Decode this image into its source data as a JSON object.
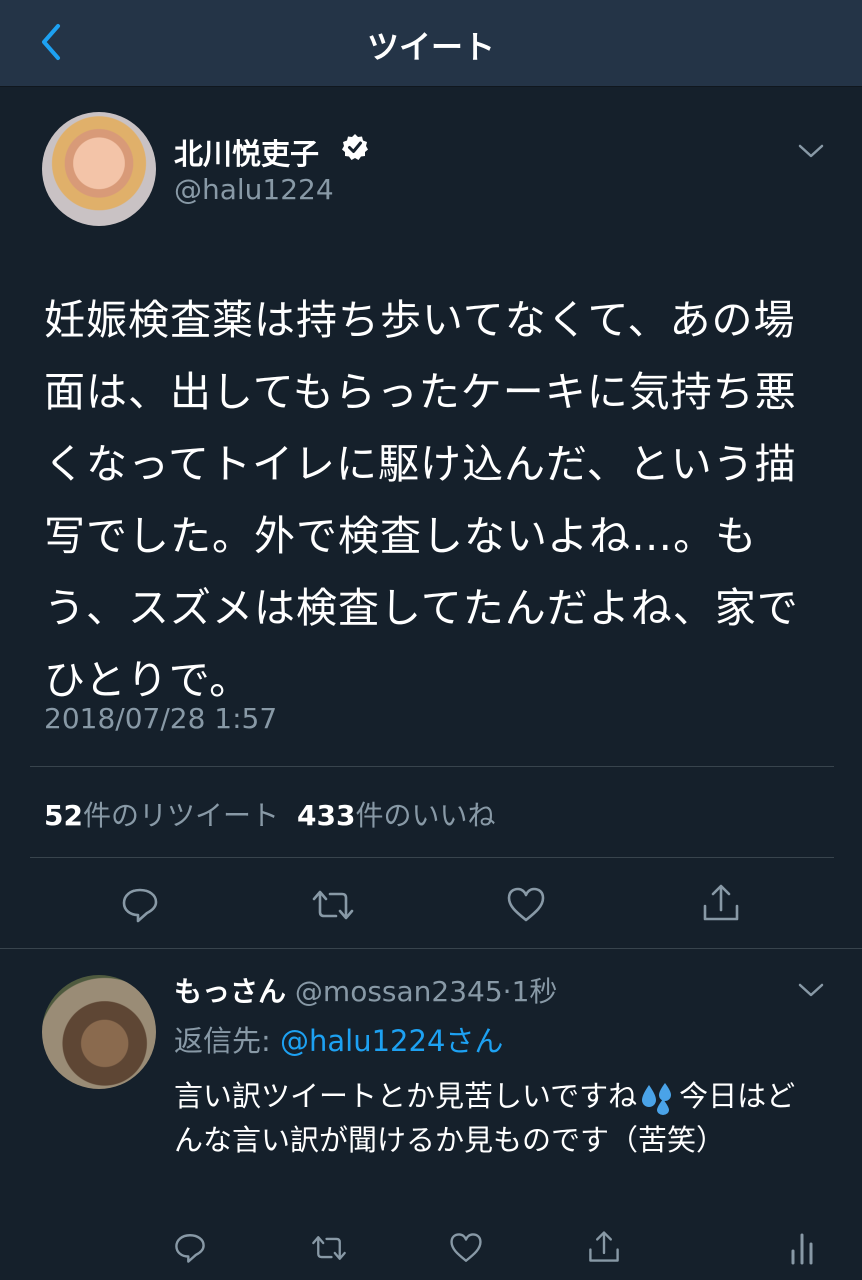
{
  "navbar": {
    "title": "ツイート",
    "back_icon": "chevron-left-icon",
    "accent": "#1da1f2"
  },
  "tweet": {
    "author_name": "北川悦吏子",
    "author_handle": "@halu1224",
    "verified": true,
    "text": "妊娠検査薬は持ち歩いてなくて、あの場面は、出してもらったケーキに気持ち悪くなってトイレに駆け込んだ、という描写でした。外で検査しないよね…。もう、スズメは検査してたんだよね、家でひとりで。",
    "timestamp": "2018/07/28 1:57",
    "retweet_count": "52",
    "retweet_label": "件のリツイート",
    "like_count": "433",
    "like_label": "件のいいね"
  },
  "reply": {
    "author_name": "もっさん",
    "author_handle": "@mossan2345",
    "separator": "·",
    "time": "1秒",
    "reply_to_label": "返信先:",
    "reply_to_handle": "@halu1224さん",
    "text_before_emoji": "言い訳ツイートとか見苦しいですね",
    "emoji": "sweat-droplets-icon",
    "text_after_emoji": "今日はどんな言い訳が聞けるか見ものです（苦笑）"
  },
  "colors": {
    "background": "#15202b",
    "navbar": "#243447",
    "secondary_text": "#8899a6",
    "link": "#1da1f2",
    "divider": "#38444d"
  }
}
